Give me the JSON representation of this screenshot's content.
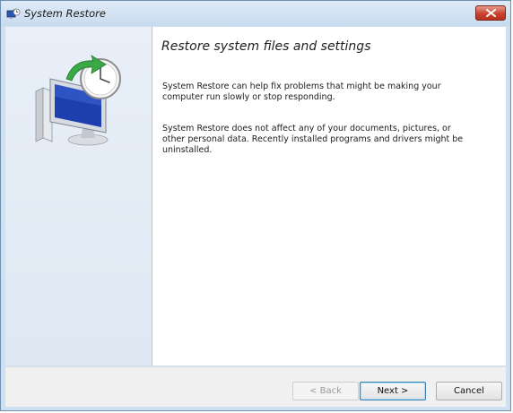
{
  "window": {
    "title": "System Restore"
  },
  "content": {
    "heading": "Restore system files and settings",
    "paragraph1": "System Restore can help fix problems that might be making your computer run slowly or stop responding.",
    "paragraph2": "System Restore does not affect any of your documents, pictures, or other personal data. Recently installed programs and drivers might be uninstalled."
  },
  "buttons": {
    "back": "< Back",
    "next": "Next >",
    "cancel": "Cancel"
  },
  "colors": {
    "titlebar": "#c7dbef",
    "close": "#c8432f",
    "sidebar": "#e8eff8",
    "default_button_border": "#3c7fb1"
  },
  "icons": {
    "title": "system-restore-icon",
    "hero": "computer-clock-restore-icon",
    "close": "close-icon"
  }
}
